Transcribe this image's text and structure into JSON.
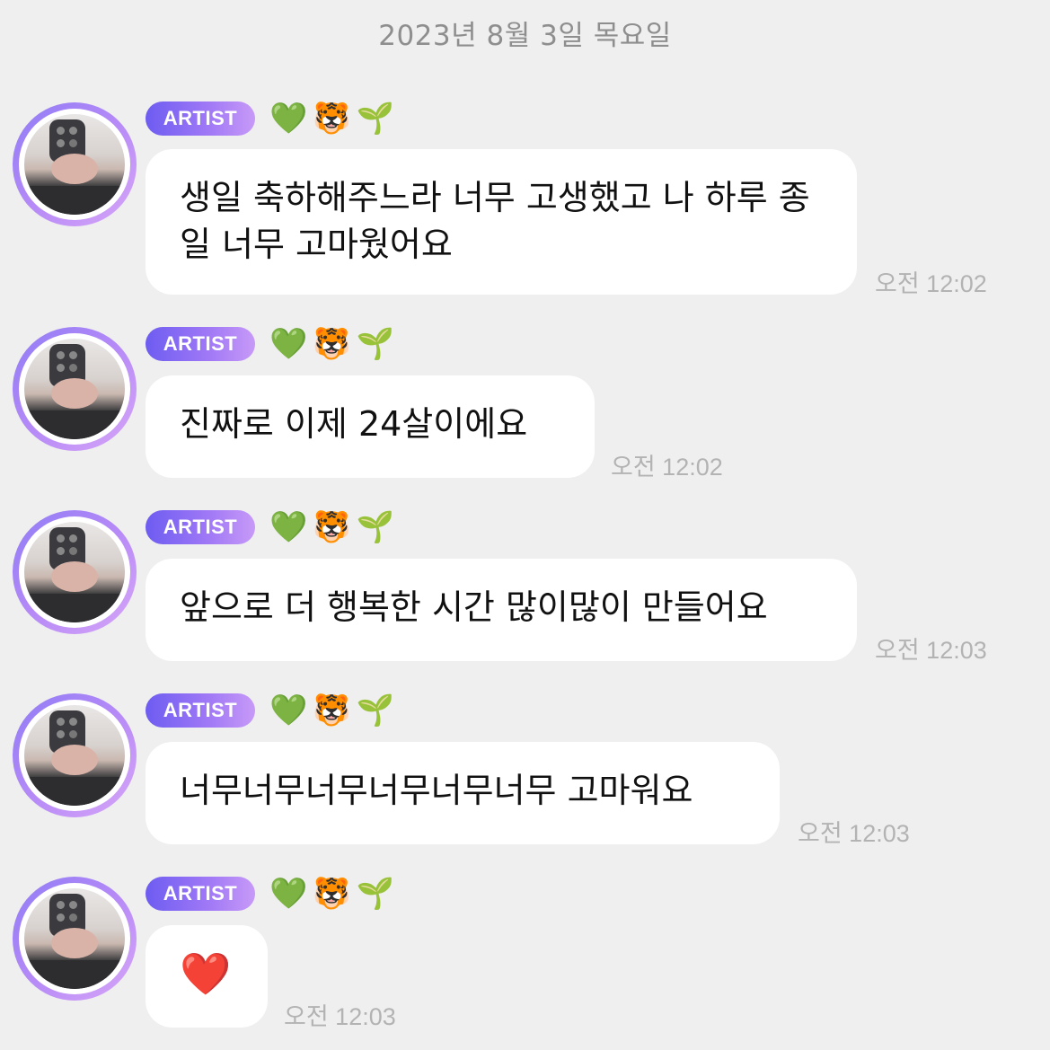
{
  "date_header": "2023년 8월 3일 목요일",
  "sender": {
    "badge": "ARTIST",
    "emojis": [
      "💚",
      "🐯",
      "🌱"
    ],
    "avatar_icon": "avatar-photo"
  },
  "messages": [
    {
      "text": "생일 축하해주느라 너무 고생했고 나 하루 종일 너무 고마웠어요",
      "time": "오전 12:02"
    },
    {
      "text": "진짜로 이제 24살이에요",
      "time": "오전 12:02"
    },
    {
      "text": "앞으로 더 행복한 시간 많이많이 만들어요",
      "time": "오전 12:03"
    },
    {
      "text": "너무너무너무너무너무너무 고마워요",
      "time": "오전 12:03"
    },
    {
      "text": "❤️",
      "time": "오전 12:03"
    }
  ],
  "colors": {
    "background": "#efefef",
    "badge_gradient_start": "#6d5cf1",
    "badge_gradient_end": "#c79af7",
    "bubble": "#ffffff",
    "timestamp": "#b3b3b3"
  }
}
